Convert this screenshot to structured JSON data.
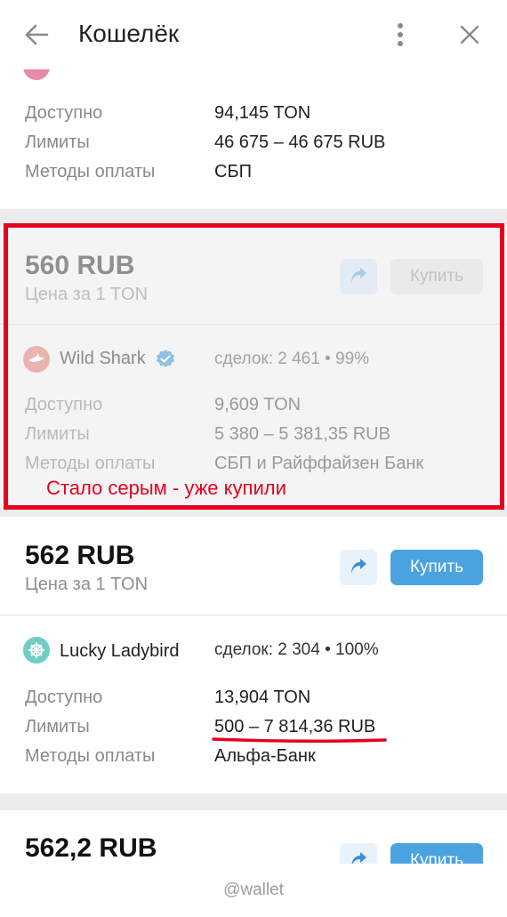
{
  "header": {
    "title": "Кошелёк"
  },
  "labels": {
    "available": "Доступно",
    "limits": "Лимиты",
    "payment_methods": "Методы оплаты",
    "price_per": "Цена за 1 TON",
    "buy": "Купить"
  },
  "offers": [
    {
      "available": "94,145 TON",
      "limits": "46 675 – 46 675 RUB",
      "methods": "СБП"
    },
    {
      "price": "560 RUB",
      "merchant": "Wild Shark",
      "verified": true,
      "deals": "сделок: 2 461 • 99%",
      "available": "9,609 TON",
      "limits": "5 380 – 5 381,35 RUB",
      "methods": "СБП и Райффайзен Банк",
      "disabled": true
    },
    {
      "price": "562 RUB",
      "merchant": "Lucky Ladybird",
      "deals": "сделок: 2 304 • 100%",
      "available": "13,904 TON",
      "limits": "500 – 7 814,36 RUB",
      "methods": "Альфа-Банк"
    },
    {
      "price": "562,2 RUB"
    }
  ],
  "annotation": {
    "text": "Стало серым - уже купили",
    "color": "#e6001f"
  },
  "footer": {
    "text": "@wallet"
  },
  "colors": {
    "accent": "#4aa3df",
    "share_bg": "#e8f2fb"
  }
}
